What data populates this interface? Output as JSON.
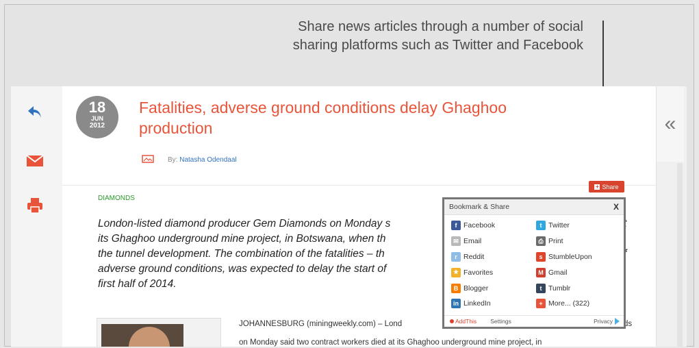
{
  "callout": {
    "line1": "Share news articles through a number of social",
    "line2": "sharing platforms such as Twitter and Facebook"
  },
  "left_actions": [
    {
      "name": "reply-icon",
      "glyph": "↰"
    },
    {
      "name": "email-icon",
      "glyph": "✉"
    },
    {
      "name": "print-icon",
      "glyph": "⎙"
    }
  ],
  "article": {
    "date": {
      "day": "18",
      "month": "JUN",
      "year": "2012"
    },
    "title": "Fatalities, adverse ground conditions delay Ghaghoo production",
    "by_label": "By:",
    "author": "Natasha Odendaal",
    "category": "DIAMONDS",
    "lead_lines": [
      "London-listed diamond producer Gem Diamonds on Monday s",
      "its Ghaghoo underground mine project, in Botswana, when th",
      "the tunnel development. The combination of the fatalities – th",
      "adverse ground conditions, was expected to delay the start of",
      "first half of 2014."
    ],
    "lead_overflow_right": [
      "t",
      "f"
    ],
    "body_lines": [
      "JOHANNESBURG (miningweekly.com) – Lond",
      "on Monday said two contract workers died at its Ghaghoo underground mine project, in"
    ],
    "body_overflow_right": "ds"
  },
  "collapse_glyph": "«",
  "share_button": {
    "label": "Share",
    "plus": "+"
  },
  "share_popup": {
    "title": "Bookmark & Share",
    "close": "X",
    "services": [
      {
        "label": "Facebook",
        "icon": "facebook-icon",
        "glyph": "f",
        "color": "#3b5998"
      },
      {
        "label": "Twitter",
        "icon": "twitter-icon",
        "glyph": "t",
        "color": "#2fa8e0"
      },
      {
        "label": "Email",
        "icon": "email-icon",
        "glyph": "✉",
        "color": "#b9b9b9"
      },
      {
        "label": "Print",
        "icon": "print-icon",
        "glyph": "⎙",
        "color": "#6a6a6a"
      },
      {
        "label": "Reddit",
        "icon": "reddit-icon",
        "glyph": "r",
        "color": "#8fbde6"
      },
      {
        "label": "StumbleUpon",
        "icon": "stumbleupon-icon",
        "glyph": "s",
        "color": "#e0452c"
      },
      {
        "label": "Favorites",
        "icon": "favorites-icon",
        "glyph": "★",
        "color": "#f2b02b"
      },
      {
        "label": "Gmail",
        "icon": "gmail-icon",
        "glyph": "M",
        "color": "#d0402f"
      },
      {
        "label": "Blogger",
        "icon": "blogger-icon",
        "glyph": "B",
        "color": "#f57d00"
      },
      {
        "label": "Tumblr",
        "icon": "tumblr-icon",
        "glyph": "t",
        "color": "#35465c"
      },
      {
        "label": "LinkedIn",
        "icon": "linkedin-icon",
        "glyph": "in",
        "color": "#2d75b3"
      },
      {
        "label": "More... (322)",
        "icon": "more-icon",
        "glyph": "+",
        "color": "#e8543a"
      }
    ],
    "footer": {
      "addthis": "AddThis",
      "settings": "Settings",
      "privacy": "Privacy"
    }
  }
}
